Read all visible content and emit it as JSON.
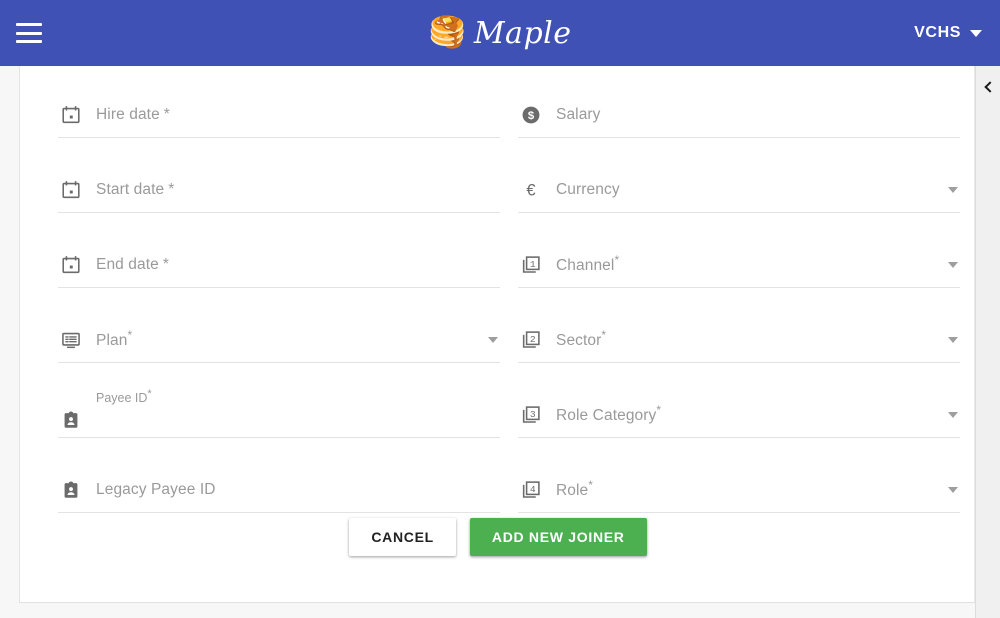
{
  "appbar": {
    "menu_icon": "hamburger-menu-icon",
    "brand_mark": "🥞",
    "brand_name": "Maple",
    "account_label": "VCHS",
    "account_caret_icon": "caret-down-icon",
    "background_color": "#3f51b5"
  },
  "rail": {
    "toggle_icon": "chevron-left-icon"
  },
  "form": {
    "fields": [
      {
        "name": "hire-date",
        "label": "Hire date",
        "required_marker": "*",
        "marker_style": "spaced",
        "icon": "calendar-icon",
        "type": "date",
        "has_dropdown": false,
        "value": "",
        "floated": false
      },
      {
        "name": "salary",
        "label": "Salary",
        "required_marker": "",
        "marker_style": "spaced",
        "icon": "monetization-dollar-icon",
        "type": "number",
        "has_dropdown": false,
        "value": "",
        "floated": false
      },
      {
        "name": "start-date",
        "label": "Start date",
        "required_marker": "*",
        "marker_style": "spaced",
        "icon": "calendar-icon",
        "type": "date",
        "has_dropdown": false,
        "value": "",
        "floated": false
      },
      {
        "name": "currency",
        "label": "Currency",
        "required_marker": "",
        "marker_style": "spaced",
        "icon": "euro-icon",
        "type": "select",
        "has_dropdown": true,
        "value": "",
        "floated": false
      },
      {
        "name": "end-date",
        "label": "End date",
        "required_marker": "*",
        "marker_style": "spaced",
        "icon": "calendar-icon",
        "type": "date",
        "has_dropdown": false,
        "value": "",
        "floated": false
      },
      {
        "name": "channel",
        "label": "Channel",
        "required_marker": "*",
        "marker_style": "tight",
        "icon": "filter-1-icon",
        "type": "select",
        "has_dropdown": true,
        "value": "",
        "floated": false
      },
      {
        "name": "plan",
        "label": "Plan",
        "required_marker": "*",
        "marker_style": "tight",
        "icon": "list-icon",
        "type": "select",
        "has_dropdown": true,
        "value": "",
        "floated": false
      },
      {
        "name": "sector",
        "label": "Sector",
        "required_marker": "*",
        "marker_style": "tight",
        "icon": "filter-2-icon",
        "type": "select",
        "has_dropdown": true,
        "value": "",
        "floated": false
      },
      {
        "name": "payee-id",
        "label": "Payee ID",
        "required_marker": "*",
        "marker_style": "tight",
        "icon": "badge-person-icon",
        "type": "text",
        "has_dropdown": false,
        "value": "",
        "floated": true
      },
      {
        "name": "role-category",
        "label": "Role Category",
        "required_marker": "*",
        "marker_style": "tight",
        "icon": "filter-3-icon",
        "type": "select",
        "has_dropdown": true,
        "value": "",
        "floated": false
      },
      {
        "name": "legacy-payee-id",
        "label": "Legacy Payee ID",
        "required_marker": "",
        "marker_style": "spaced",
        "icon": "badge-person-icon",
        "type": "text",
        "has_dropdown": false,
        "value": "",
        "floated": false
      },
      {
        "name": "role",
        "label": "Role",
        "required_marker": "*",
        "marker_style": "tight",
        "icon": "filter-4-icon",
        "type": "select",
        "has_dropdown": true,
        "value": "",
        "floated": false
      }
    ]
  },
  "actions": {
    "cancel_label": "CANCEL",
    "submit_label": "ADD NEW JOINER",
    "submit_color": "#4caf50"
  }
}
